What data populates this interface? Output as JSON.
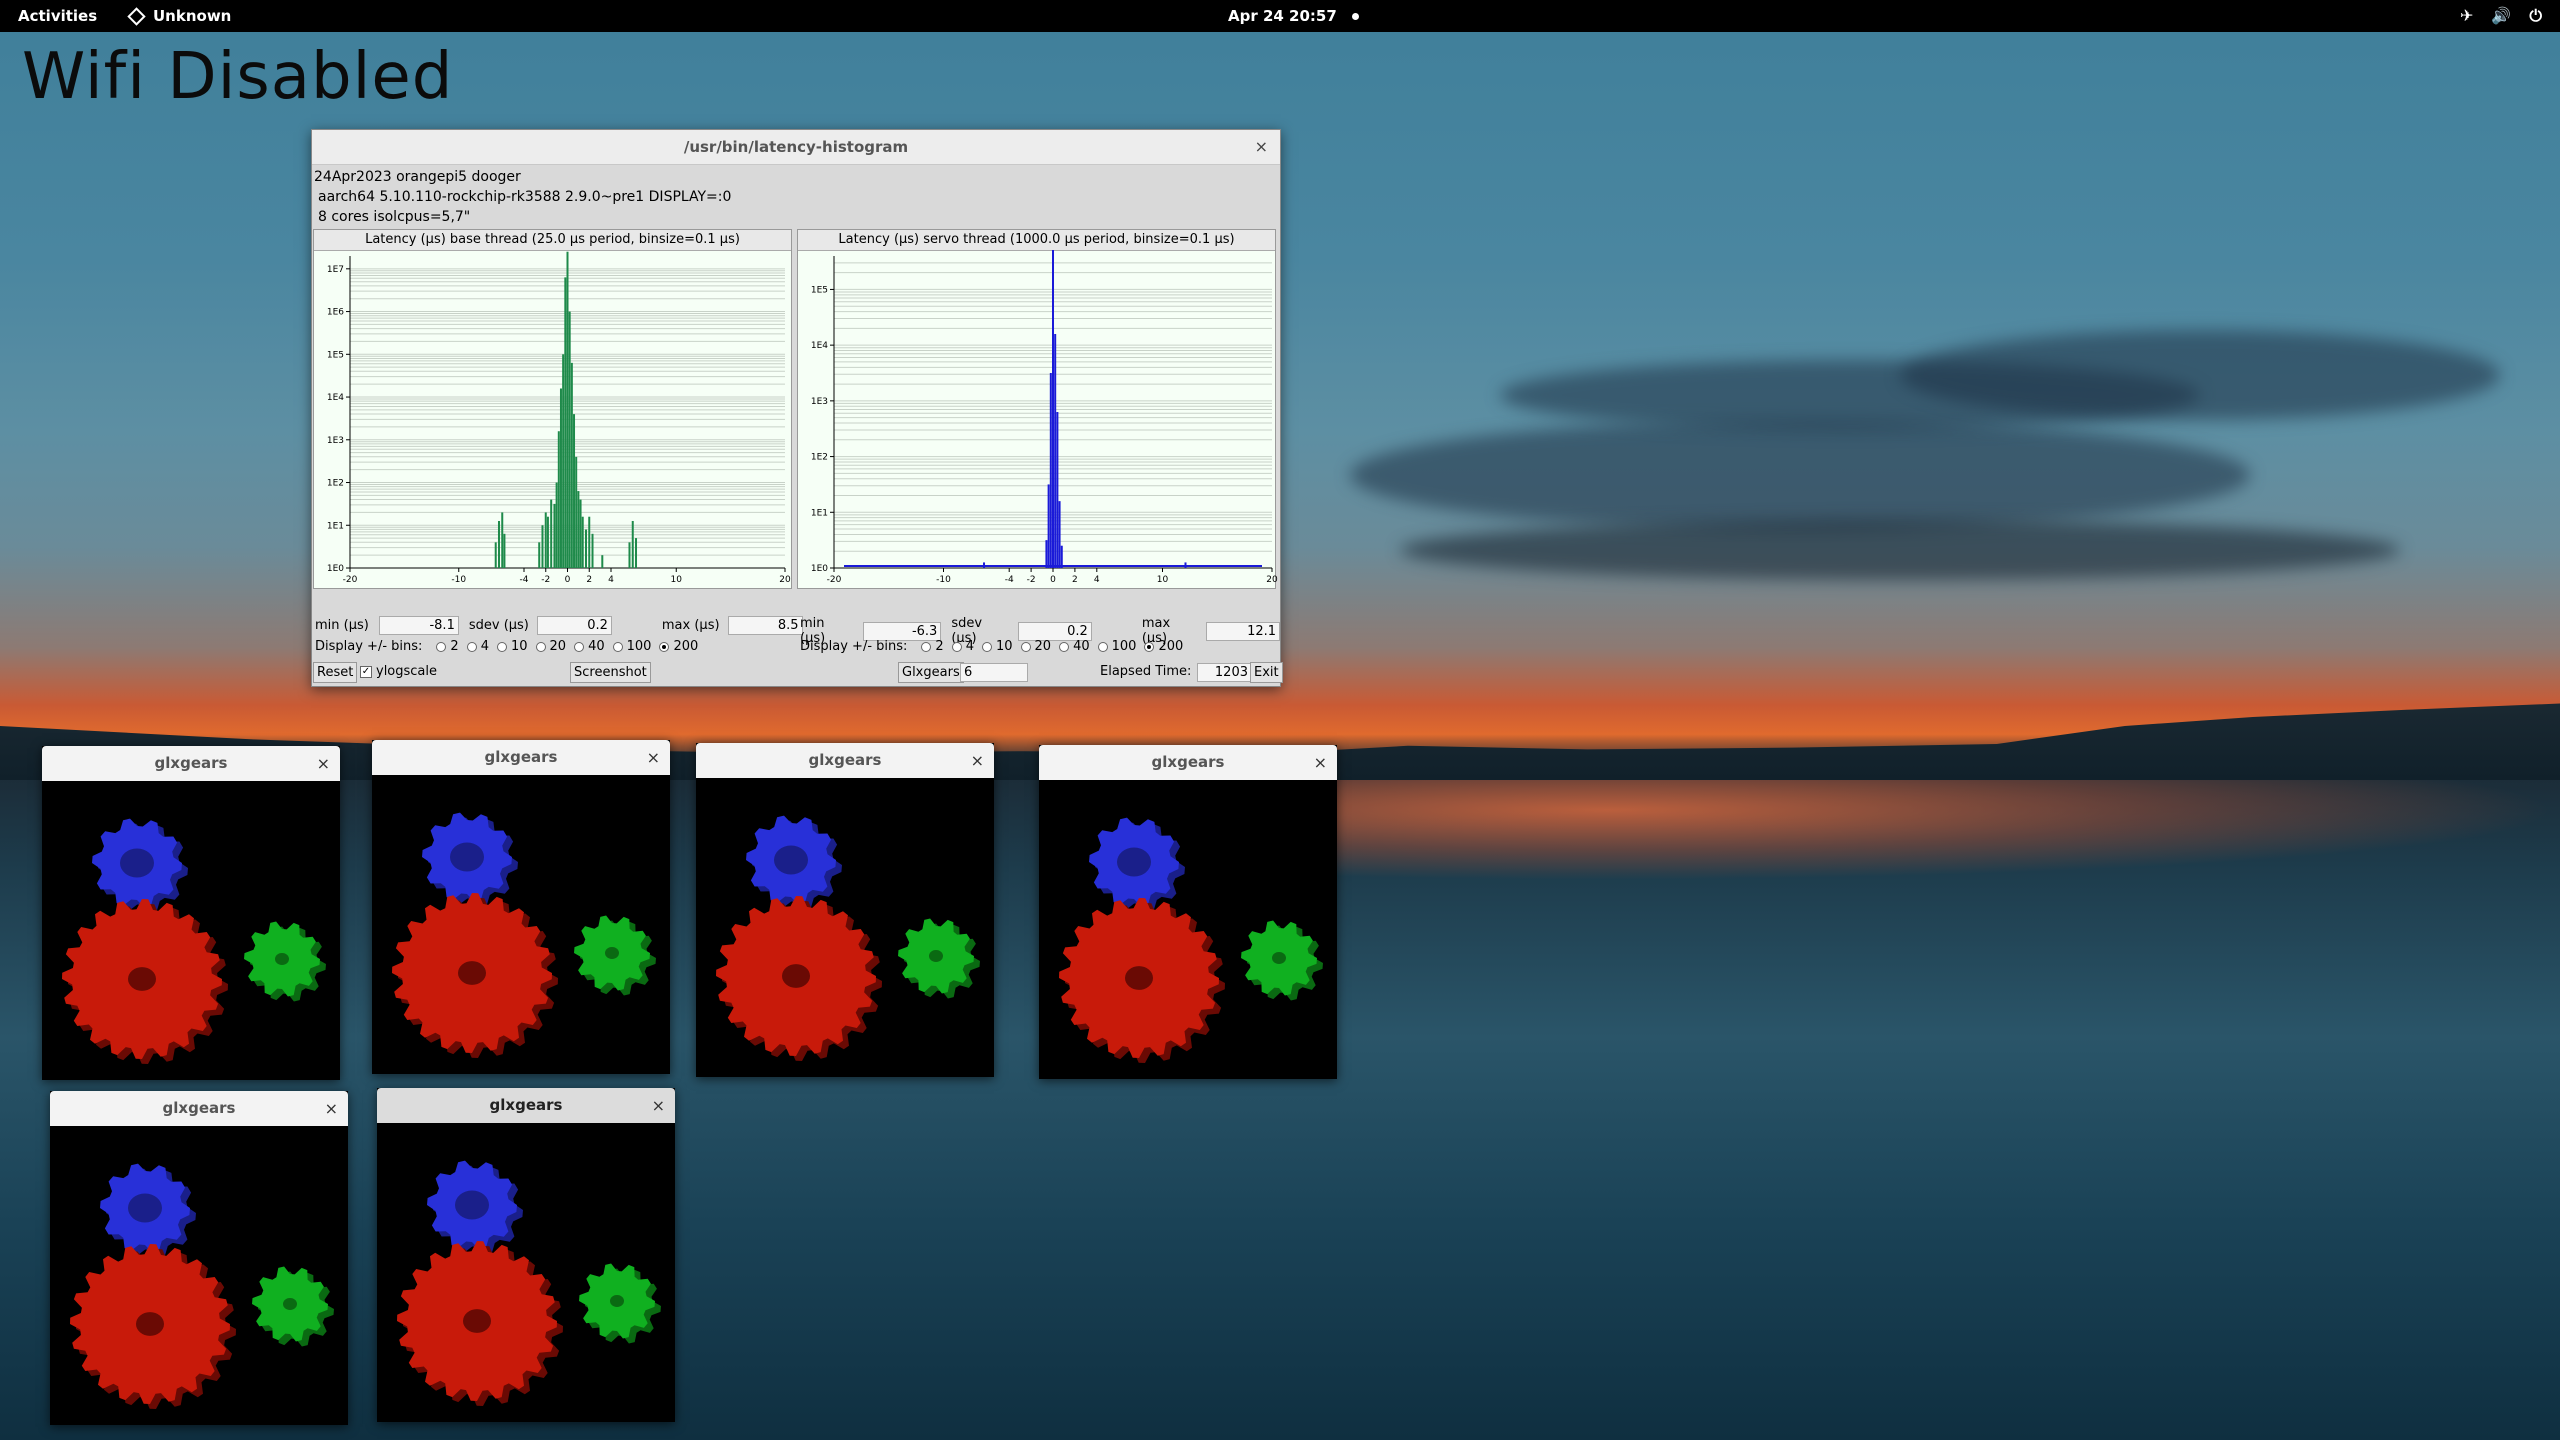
{
  "topbar": {
    "activities": "Activities",
    "app": "Unknown",
    "clock": "Apr 24  20:57",
    "icons": [
      "airplane-icon",
      "volume-icon",
      "power-icon"
    ]
  },
  "desktop": {
    "overlay_text": "Wifi Disabled"
  },
  "latency": {
    "window_title": "/usr/bin/latency-histogram",
    "info": [
      "24Apr2023 orangepi5 dooger",
      "aarch64  5.10.110-rockchip-rk3588  2.9.0~pre1  DISPLAY=:0",
      "8 cores  isolcpus=5,7\""
    ],
    "base": {
      "title": "Latency (µs) base thread (25.0 µs period, binsize=0.1 µs)",
      "min_label": "min (µs)",
      "min": "-8.1",
      "sdev_label": "sdev (µs)",
      "sdev": "0.2",
      "max_label": "max (µs)",
      "max": "8.5"
    },
    "servo": {
      "title": "Latency (µs) servo thread (1000.0 µs period, binsize=0.1 µs)",
      "min_label": "min (µs)",
      "min": "-6.3",
      "sdev_label": "sdev (µs)",
      "sdev": "0.2",
      "max_label": "max (µs)",
      "max": "12.1"
    },
    "bins_label": "Display +/- bins:",
    "bins": [
      "2",
      "4",
      "10",
      "20",
      "40",
      "100",
      "200"
    ],
    "bins_selected": "200",
    "reset": "Reset",
    "ylogscale": "ylogscale",
    "screenshot": "Screenshot",
    "glxgears_label": "Glxgears",
    "glxgears_count": "6",
    "elapsed_label": "Elapsed Time:",
    "elapsed": "1203",
    "exit": "Exit"
  },
  "chart_data": [
    {
      "type": "bar",
      "title": "Latency (µs) base thread (25.0 µs period, binsize=0.1 µs)",
      "xticks": [
        "-20",
        "-10",
        "-4",
        "-2",
        "0",
        "2",
        "4",
        "10",
        "20"
      ],
      "yticks": [
        "1E0",
        "1E1",
        "1E2",
        "1E3",
        "1E4",
        "1E5",
        "1E6",
        "1E7"
      ],
      "xlim": [
        -20,
        20
      ],
      "ylog_exponent_range": [
        0,
        7.3
      ],
      "color": "#1e8a4a",
      "x": [
        -6.6,
        -6.3,
        -6.0,
        -5.8,
        -2.6,
        -2.3,
        -2.0,
        -1.8,
        -1.5,
        -1.2,
        -1.0,
        -0.8,
        -0.6,
        -0.4,
        -0.2,
        0.0,
        0.2,
        0.4,
        0.6,
        0.8,
        1.0,
        1.2,
        1.4,
        1.7,
        2.0,
        2.3,
        3.2,
        5.7,
        6.0,
        6.3
      ],
      "y_log10": [
        0.6,
        1.1,
        1.3,
        0.8,
        0.6,
        1.0,
        1.3,
        1.2,
        1.6,
        1.5,
        2.0,
        3.2,
        4.2,
        5.0,
        6.8,
        7.4,
        6.0,
        4.8,
        3.6,
        2.6,
        1.8,
        1.6,
        1.2,
        0.9,
        1.2,
        0.8,
        0.3,
        0.6,
        1.1,
        0.7
      ]
    },
    {
      "type": "bar",
      "title": "Latency (µs) servo thread (1000.0 µs period, binsize=0.1 µs)",
      "xticks": [
        "-20",
        "-10",
        "-4",
        "-2",
        "0",
        "2",
        "4",
        "10",
        "20"
      ],
      "yticks": [
        "1E0",
        "1E1",
        "1E2",
        "1E3",
        "1E4",
        "1E5"
      ],
      "xlim": [
        -20,
        20
      ],
      "ylog_exponent_range": [
        0,
        5.6
      ],
      "color": "#1a1ad8",
      "x": [
        -6.3,
        -0.6,
        -0.4,
        -0.2,
        0.0,
        0.2,
        0.4,
        0.6,
        0.8,
        12.1
      ],
      "y_log10": [
        0.1,
        0.5,
        1.5,
        3.5,
        5.8,
        4.2,
        2.8,
        1.2,
        0.4,
        0.1
      ]
    }
  ],
  "glxgears": [
    {
      "title": "glxgears",
      "close": "×"
    },
    {
      "title": "glxgears",
      "close": "×"
    },
    {
      "title": "glxgears",
      "close": "×"
    },
    {
      "title": "glxgears",
      "close": "×"
    },
    {
      "title": "glxgears",
      "close": "×"
    },
    {
      "title": "glxgears",
      "close": "×"
    }
  ],
  "colors": {
    "gear_red": "#c81a0a",
    "gear_green": "#10b020",
    "gear_blue": "#2830d8"
  }
}
